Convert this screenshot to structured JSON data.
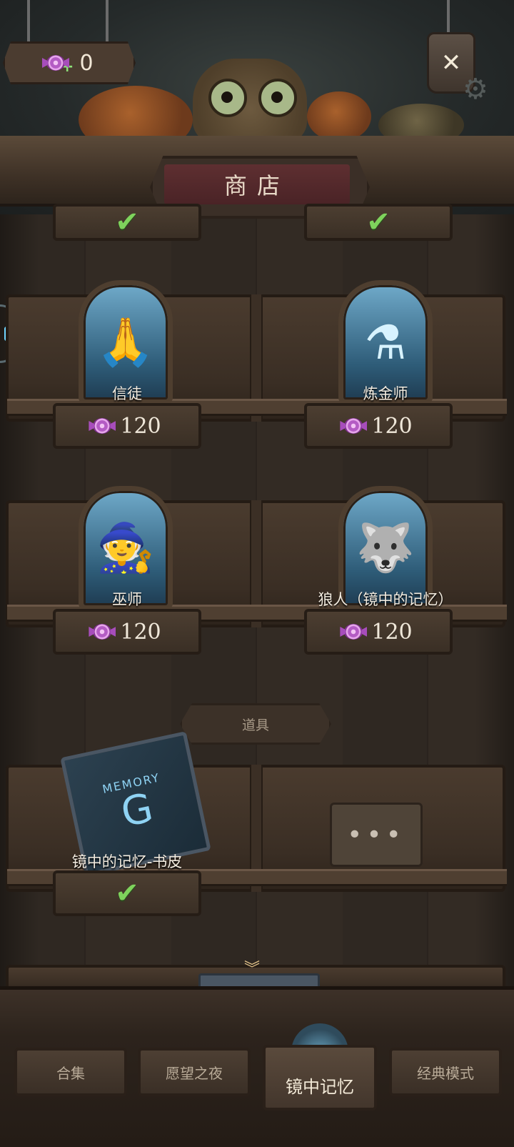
{
  "header": {
    "candy_count": "0",
    "title": "商店",
    "close_glyph": "✕",
    "gear_glyph": "⚙"
  },
  "roles": [
    {
      "name": "信徒",
      "price": "120",
      "icon": "praying-hands-icon",
      "glyph": "🙏"
    },
    {
      "name": "炼金师",
      "price": "120",
      "icon": "potion-icon",
      "glyph": "⚗"
    },
    {
      "name": "巫师",
      "price": "120",
      "icon": "wizard-hat-icon",
      "glyph": "🧙"
    },
    {
      "name": "狼人（镜中的记忆）",
      "price": "120",
      "icon": "wolf-icon",
      "glyph": "🐺"
    }
  ],
  "section": {
    "label": "道具"
  },
  "items": [
    {
      "name": "镜中的记忆-书皮",
      "owned": true,
      "book_title": "MEMORY"
    },
    {
      "more_glyph": "•••"
    }
  ],
  "check_glyph": "✔",
  "tabs": [
    {
      "label": "合集"
    },
    {
      "label": "愿望之夜"
    },
    {
      "label": "镜中记忆",
      "active": true
    },
    {
      "label": "经典模式"
    }
  ],
  "colors": {
    "accent_green": "#7ed35c",
    "candy_purple": "#b45cc4",
    "card_blue": "#6fa9c9"
  }
}
